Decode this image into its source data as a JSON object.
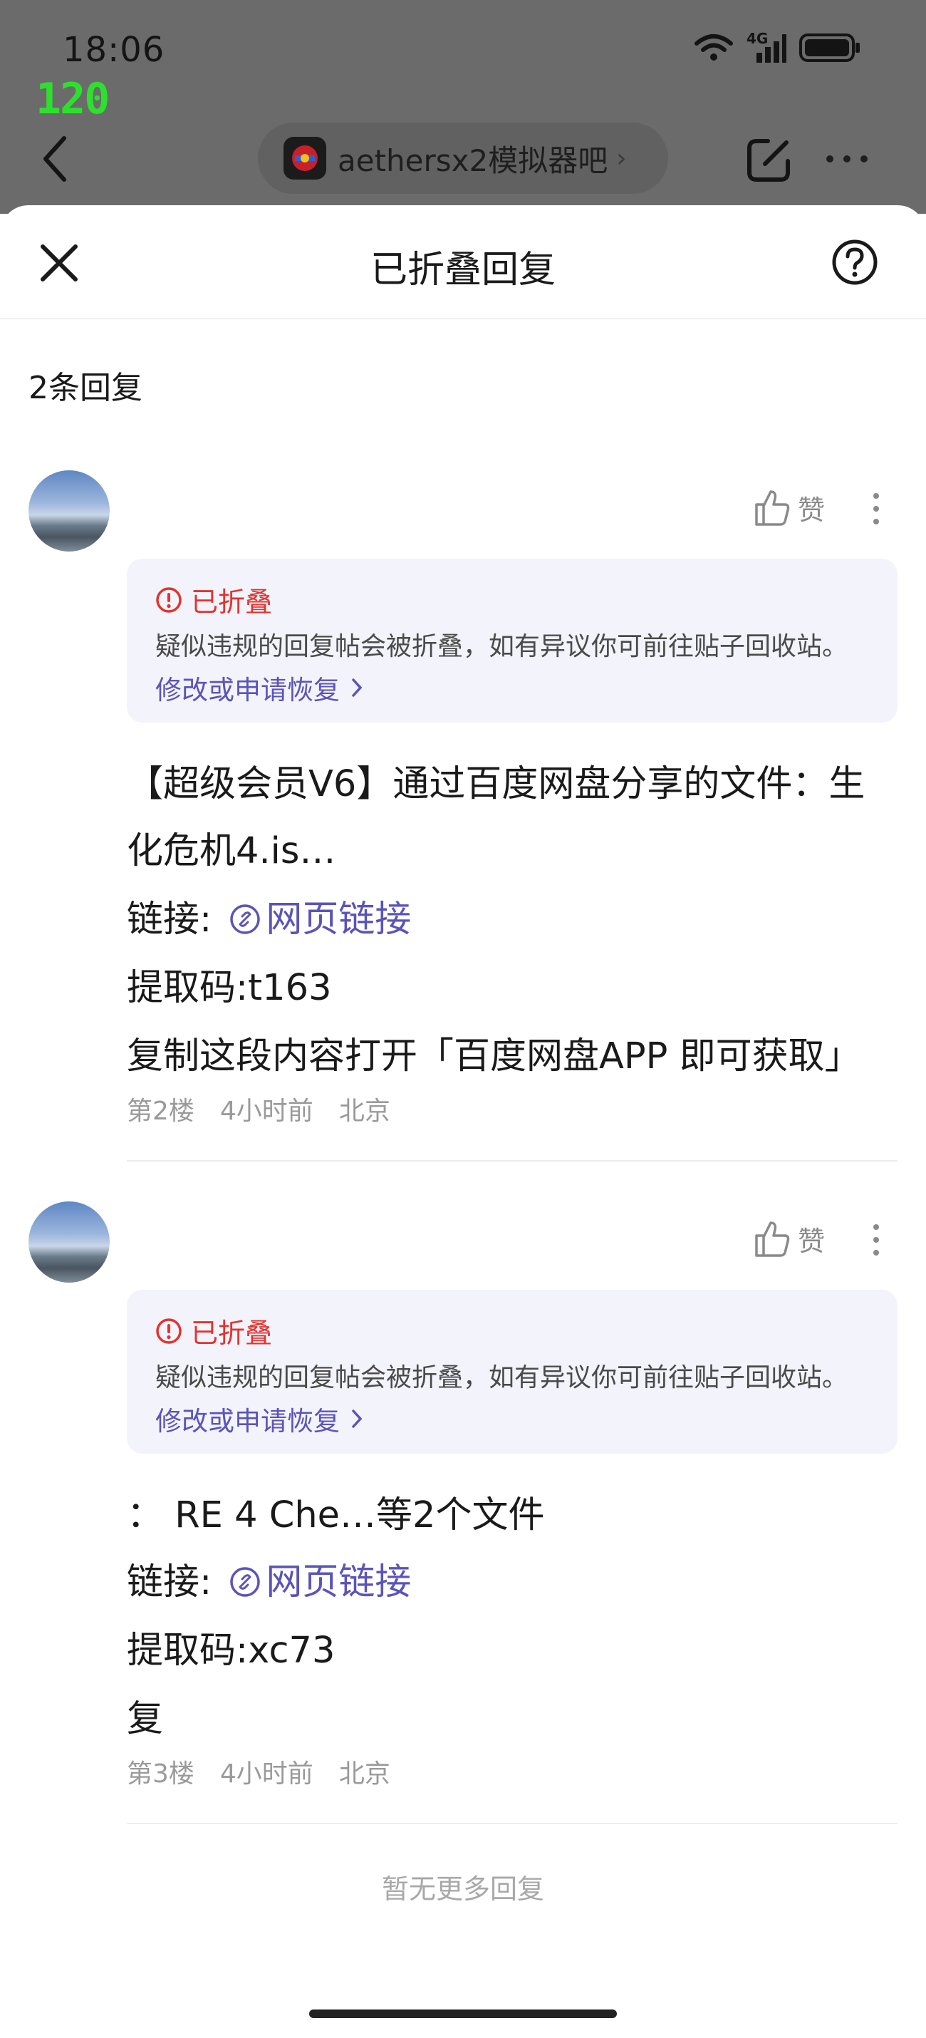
{
  "status_bar": {
    "time": "18:06",
    "fps": "120",
    "network": "4G"
  },
  "nav": {
    "forum_name": "aethersx2模拟器吧"
  },
  "sheet": {
    "title": "已折叠回复",
    "reply_count": "2条回复"
  },
  "posts": [
    {
      "like_label": "赞",
      "notice": {
        "title": "已折叠",
        "text": "疑似违规的回复帖会被折叠，如有异议你可前往贴子回收站。",
        "link": "修改或申请恢复"
      },
      "content": {
        "line1": "【超级会员V6】通过百度网盘分享的文件：生",
        "line2": "化危机4.is…",
        "link_prefix": "链接:",
        "link_text": "网页链接",
        "code": "提取码:t163",
        "extra": "复制这段内容打开「百度网盘APP 即可获取」"
      },
      "meta": {
        "floor": "第2楼",
        "time": "4小时前",
        "location": "北京"
      }
    },
    {
      "like_label": "赞",
      "notice": {
        "title": "已折叠",
        "text": "疑似违规的回复帖会被折叠，如有异议你可前往贴子回收站。",
        "link": "修改或申请恢复"
      },
      "content": {
        "line1": "：  RE 4 Che…等2个文件",
        "link_prefix": "链接:",
        "link_text": "网页链接",
        "code": "提取码:xc73",
        "extra": "复"
      },
      "meta": {
        "floor": "第3楼",
        "time": "4小时前",
        "location": "北京"
      }
    }
  ],
  "footer": {
    "no_more": "暂无更多回复"
  },
  "colors": {
    "accent": "#5b54b8",
    "warning": "#e5322d",
    "notice_bg": "#f3f3fc"
  }
}
